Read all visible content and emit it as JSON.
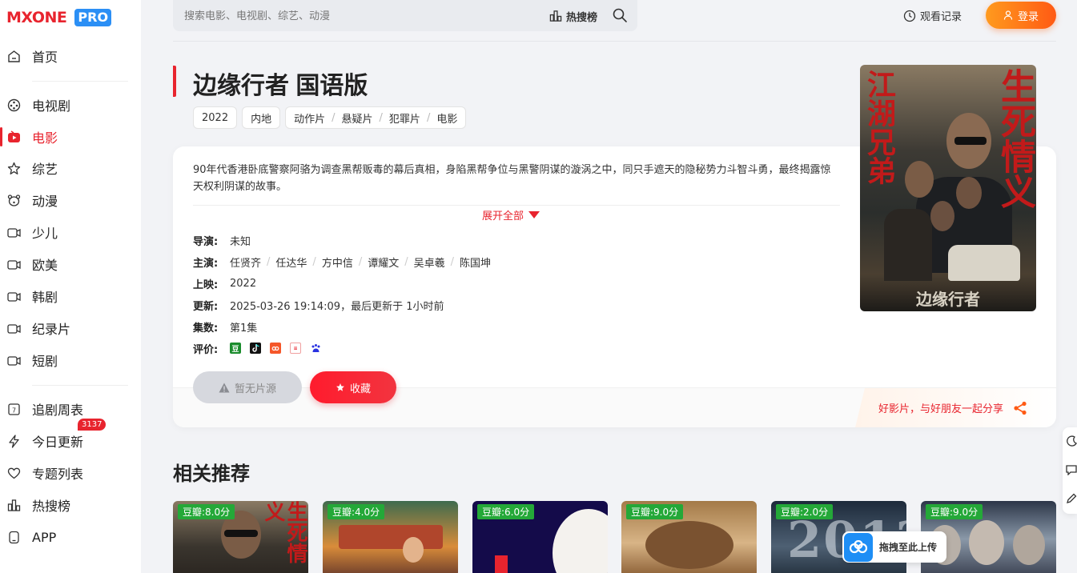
{
  "brand": {
    "name": "MXONE",
    "edition": "PRO"
  },
  "sidebar": {
    "items": [
      {
        "label": "首页",
        "icon": "home-icon"
      },
      {
        "label": "电视剧",
        "icon": "film-reel-icon"
      },
      {
        "label": "电影",
        "icon": "movie-play-icon",
        "active": true
      },
      {
        "label": "综艺",
        "icon": "star-outline-icon"
      },
      {
        "label": "动漫",
        "icon": "bear-face-icon"
      },
      {
        "label": "少儿",
        "icon": "video-camera-icon"
      },
      {
        "label": "欧美",
        "icon": "video-camera-icon"
      },
      {
        "label": "韩剧",
        "icon": "video-camera-icon"
      },
      {
        "label": "纪录片",
        "icon": "video-camera-icon"
      },
      {
        "label": "短剧",
        "icon": "video-camera-icon"
      }
    ],
    "tools": [
      {
        "label": "追剧周表",
        "icon": "calendar-icon"
      },
      {
        "label": "今日更新",
        "icon": "lightning-icon",
        "badge": "3137"
      },
      {
        "label": "专题列表",
        "icon": "heart-icon"
      },
      {
        "label": "热搜榜",
        "icon": "bar-chart-icon"
      },
      {
        "label": "APP",
        "icon": "phone-icon"
      }
    ]
  },
  "header": {
    "search_placeholder": "搜索电影、电视剧、综艺、动漫",
    "hot_label": "热搜榜",
    "history_label": "观看记录",
    "login_label": "登录"
  },
  "movie": {
    "title": "边缘行者 国语版",
    "tags": {
      "year": "2022",
      "region": "内地",
      "genres": [
        "动作片",
        "悬疑片",
        "犯罪片",
        "电影"
      ]
    },
    "description": "90年代香港卧底警察阿骆为调查黑帮贩毒的幕后真相，身陷黑帮争位与黑警阴谋的漩涡之中，同只手遮天的隐秘势力斗智斗勇，最终揭露惊天权利阴谋的故事。",
    "expand_label": "展开全部",
    "director": {
      "label": "导演:",
      "value": "未知"
    },
    "cast": {
      "label": "主演:",
      "values": [
        "任贤齐",
        "任达华",
        "方中信",
        "谭耀文",
        "吴卓羲",
        "陈国坤"
      ]
    },
    "release": {
      "label": "上映:",
      "value": "2022"
    },
    "update": {
      "label": "更新:",
      "value": "2025-03-26 19:14:09，最后更新于 1小时前"
    },
    "episodes": {
      "label": "集数:",
      "value": "第1集"
    },
    "rating": {
      "label": "评价:",
      "icons": [
        "douban-icon",
        "douyin-icon",
        "maoyan-icon",
        "toutiao-icon",
        "baidu-icon"
      ]
    },
    "no_source_label": "暂无片源",
    "favorite_label": "收藏",
    "share_label": "好影片，与好朋友一起分享",
    "poster": {
      "left_text": "江湖兄弟",
      "right_text": "生死情义",
      "bottom_text": "边缘行者"
    }
  },
  "related": {
    "title": "相关推荐",
    "items": [
      {
        "score": "豆瓣:8.0分"
      },
      {
        "score": "豆瓣:4.0分"
      },
      {
        "score": "豆瓣:6.0分"
      },
      {
        "score": "豆瓣:9.0分"
      },
      {
        "score": "豆瓣:2.0分"
      },
      {
        "score": "豆瓣:9.0分"
      }
    ]
  },
  "upload": {
    "label": "拖拽至此上传"
  },
  "colors": {
    "accent": "#e8242e",
    "login": "#ff6a14",
    "score": "#24a838"
  }
}
